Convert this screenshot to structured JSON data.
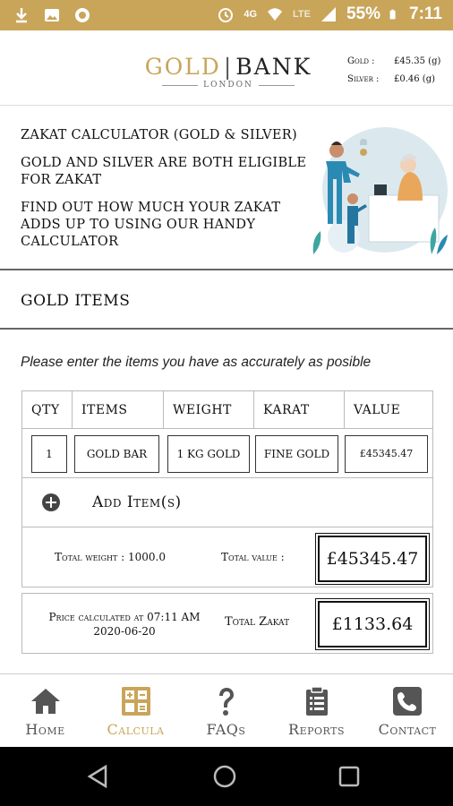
{
  "status_bar": {
    "network_4g": "4G",
    "network_lte": "LTE",
    "battery": "55%",
    "time": "7:11",
    "accent_color": "#c9a55a"
  },
  "header": {
    "logo_gold": "GOLD",
    "logo_bank": "BANK",
    "logo_city": "LONDON",
    "gold_label": "Gold :",
    "gold_price": "£45.35 (g)",
    "silver_label": "Silver :",
    "silver_price": "£0.46 (g)"
  },
  "intro": {
    "title": "ZAKAT CALCULATOR (GOLD & SILVER)",
    "line2": "GOLD AND SILVER ARE BOTH ELIGIBLE FOR ZAKAT",
    "line3": "FIND OUT HOW MUCH YOUR ZAKAT ADDS UP TO USING OUR HANDY CALCULATOR"
  },
  "gold_section": {
    "heading": "GOLD ITEMS",
    "instructions": "Please enter the items you have as accurately as posible"
  },
  "table": {
    "headers": {
      "qty": "QTY",
      "items": "ITEMS",
      "weight": "WEIGHT",
      "karat": "KARAT",
      "value": "VALUE"
    },
    "row": {
      "qty": "1",
      "item": "GOLD BAR",
      "weight": "1 KG GOLD",
      "karat": "FINE GOLD",
      "value": "£45345.47"
    },
    "add_label": "Add Item(s)",
    "total_weight": "Total weight : 1000.0",
    "total_value_label": "Total value :",
    "total_value": "£45345.47"
  },
  "zakat": {
    "calc_line1": "Price calculated at 07:11 AM",
    "calc_line2": "2020-06-20",
    "label": "Total Zakat",
    "value": "£1133.64"
  },
  "bottom_nav": {
    "home": "Home",
    "calculator": "Calcula",
    "faqs": "FAQs",
    "reports": "Reports",
    "contact": "Contact"
  }
}
